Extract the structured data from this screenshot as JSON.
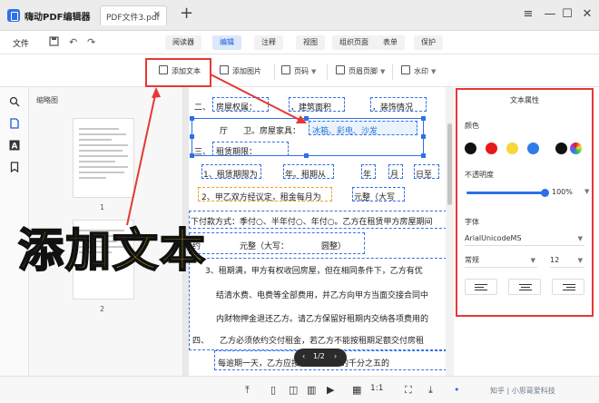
{
  "app": {
    "name": "嗨动PDF编辑器",
    "doc_tab": "PDF文件3.pdf",
    "tab_close": "✕",
    "tab_add": "+"
  },
  "window": {
    "menu": "≡",
    "min": "—",
    "max": "☐",
    "close": "✕"
  },
  "menubar": {
    "file": "文件",
    "tabs": [
      "阅读器",
      "编辑",
      "注释",
      "视图",
      "组织页面",
      "表单",
      "保护"
    ],
    "active_tab": "编辑"
  },
  "toolbar": {
    "add_text": "添加文本",
    "add_image": "添加图片",
    "page_number": "页码",
    "header_footer": "页眉页脚",
    "watermark": "水印"
  },
  "thumbnails": {
    "title": "缩略图",
    "pages": [
      "1",
      "2"
    ]
  },
  "document": {
    "line1": {
      "num": "二、",
      "a": "房屋权属：",
      "b": "，建筑面积",
      "c": "，装饰情况"
    },
    "line2": {
      "a": "厅",
      "b": "卫。房屋家具：",
      "selected": "冰箱、彩电、沙发"
    },
    "line3": {
      "num": "三、",
      "a": "租赁期限："
    },
    "line4": {
      "a": "1、租赁期限为",
      "b": "年。租期从",
      "c": "年",
      "d": "月",
      "e": "日至"
    },
    "line5": {
      "a": "2、甲乙双方经议定，租金每月为",
      "b": "元整（大写"
    },
    "line6": "下付款方式：季付○、半年付○、年付○。乙方在租赁甲方房屋期间",
    "line7": {
      "a": "约",
      "b": "元整（大写：",
      "c": "圆整）"
    },
    "line8": "3、租期满，甲方有权收回房屋，但在相同条件下，乙方有优",
    "line9": "结清水费、电费等全部费用，并乙方向甲方当面交接合同中",
    "line10": "内财物押金退还乙方。请乙方保留好租期内交纳各项费用的",
    "line11": {
      "num": "四、",
      "a": "乙方必须依约交付租金，若乙方不能按租期足额交付房租"
    },
    "line12": "每逾期一天，乙方应按照当月租金的千分之五的",
    "pager": {
      "prev": "‹",
      "label": "1/2",
      "next": "›"
    }
  },
  "overlay_caption": "添加文本",
  "properties": {
    "title": "文本属性",
    "color_label": "颜色",
    "colors": [
      "#111111",
      "#e81919",
      "#f7d63a",
      "#2f7be8",
      "#111111"
    ],
    "opacity_label": "不透明度",
    "opacity_value": "100%",
    "opacity_fraction": 1.0,
    "font_label": "字体",
    "font_value": "ArialUnicodeMS",
    "style_value": "常规",
    "size_value": "12"
  },
  "footer": {
    "watermark_text": "知乎 | 小思哥爱科技"
  }
}
